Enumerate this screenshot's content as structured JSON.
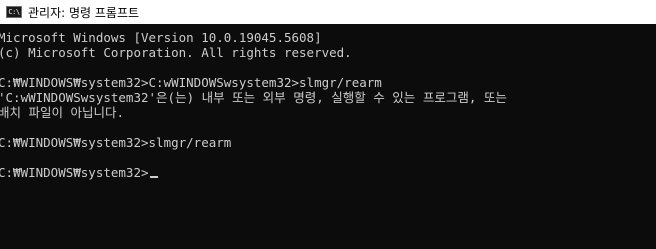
{
  "window": {
    "title": "관리자: 명령 프롬프트",
    "icon": "cmd-icon"
  },
  "console": {
    "lines": [
      "Microsoft Windows [Version 10.0.19045.5608]",
      "(c) Microsoft Corporation. All rights reserved.",
      "",
      "C:₩WINDOWS₩system32>C:wWINDOWSwsystem32>slmgr/rearm",
      "'C:wWINDOWSwsystem32'은(는) 내부 또는 외부 명령, 실행할 수 있는 프로그램, 또는",
      "배치 파일이 아닙니다.",
      "",
      "C:₩WINDOWS₩system32>slmgr/rearm",
      "",
      "C:₩WINDOWS₩system32>"
    ]
  },
  "colors": {
    "background": "#0c0c0c",
    "foreground": "#cccccc",
    "titlebar": "#ffffff"
  }
}
